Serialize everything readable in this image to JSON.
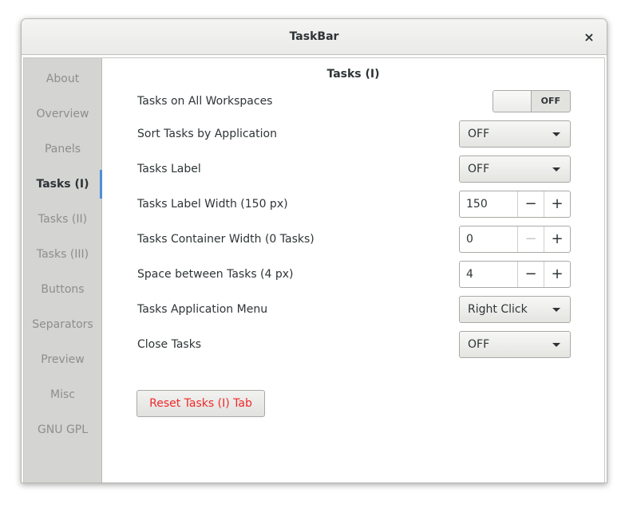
{
  "window": {
    "title": "TaskBar",
    "close_glyph": "×"
  },
  "sidebar": {
    "items": [
      {
        "label": "About",
        "active": false
      },
      {
        "label": "Overview",
        "active": false
      },
      {
        "label": "Panels",
        "active": false
      },
      {
        "label": "Tasks (I)",
        "active": true
      },
      {
        "label": "Tasks (II)",
        "active": false
      },
      {
        "label": "Tasks (III)",
        "active": false
      },
      {
        "label": "Buttons",
        "active": false
      },
      {
        "label": "Separators",
        "active": false
      },
      {
        "label": "Preview",
        "active": false
      },
      {
        "label": "Misc",
        "active": false
      },
      {
        "label": "GNU GPL",
        "active": false
      }
    ]
  },
  "main": {
    "section_title": "Tasks (I)",
    "rows": {
      "all_workspaces": {
        "label": "Tasks on All Workspaces",
        "state": "OFF"
      },
      "sort_by_app": {
        "label": "Sort Tasks by Application",
        "value": "OFF"
      },
      "tasks_label": {
        "label": "Tasks Label",
        "value": "OFF"
      },
      "label_width": {
        "label": "Tasks Label Width (150 px)",
        "value": "150",
        "minus": "−",
        "plus": "+"
      },
      "container_width": {
        "label": "Tasks Container Width (0 Tasks)",
        "value": "0",
        "minus": "−",
        "plus": "+"
      },
      "space_between": {
        "label": "Space between Tasks (4 px)",
        "value": "4",
        "minus": "−",
        "plus": "+"
      },
      "app_menu": {
        "label": "Tasks Application Menu",
        "value": "Right Click"
      },
      "close_tasks": {
        "label": "Close Tasks",
        "value": "OFF"
      }
    },
    "reset_button": "Reset Tasks (I) Tab"
  },
  "colors": {
    "accent": "#4a90d9",
    "reset_text": "#ef2929",
    "sidebar_bg": "#d4d4d2",
    "sidebar_inactive": "#8d8f8a"
  }
}
